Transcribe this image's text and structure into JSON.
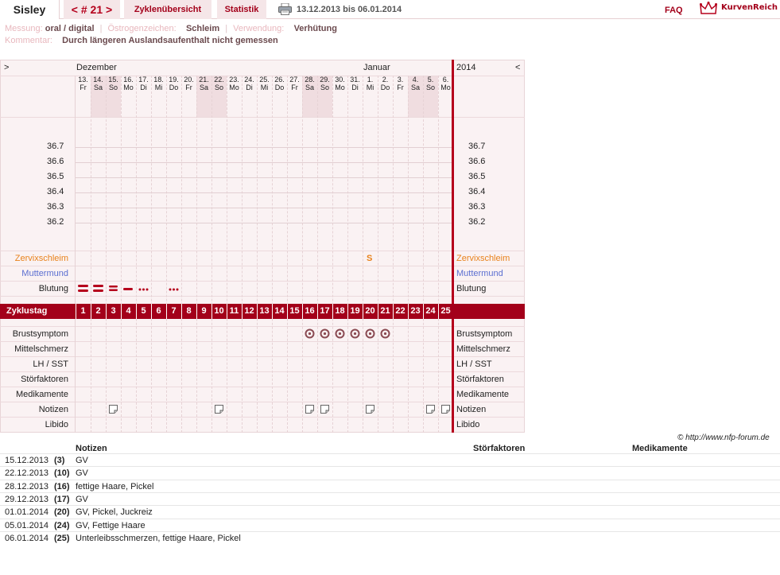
{
  "topbar": {
    "name": "Sisley",
    "cycle_prev": "<",
    "cycle_label": "# 21",
    "cycle_next": ">",
    "tab_overview": "Zyklenübersicht",
    "tab_stats": "Statistik",
    "date_range": "13.12.2013 bis 06.01.2014",
    "faq": "FAQ",
    "logo": "KurvenReich",
    "icons": [
      "printer-icon",
      "crown-logo-icon"
    ]
  },
  "meta": {
    "messung_label": "Messung:",
    "messung_value": "oral / digital",
    "oestrogen_label": "Östrogenzeichen:",
    "oestrogen_value": "Schleim",
    "verwendung_label": "Verwendung:",
    "verwendung_value": "Verhütung",
    "kommentar_label": "Kommentar:",
    "kommentar_value": "Durch längeren Auslandsaufenthalt nicht gemessen"
  },
  "chart": {
    "nav_left": ">",
    "nav_right": "<",
    "month1": "Dezember",
    "month2": "Januar",
    "year_right": "2014",
    "days": [
      {
        "d": "13.",
        "w": "Fr",
        "weekend": false
      },
      {
        "d": "14.",
        "w": "Sa",
        "weekend": true
      },
      {
        "d": "15.",
        "w": "So",
        "weekend": true
      },
      {
        "d": "16.",
        "w": "Mo",
        "weekend": false
      },
      {
        "d": "17.",
        "w": "Di",
        "weekend": false
      },
      {
        "d": "18.",
        "w": "Mi",
        "weekend": false
      },
      {
        "d": "19.",
        "w": "Do",
        "weekend": false
      },
      {
        "d": "20.",
        "w": "Fr",
        "weekend": false
      },
      {
        "d": "21.",
        "w": "Sa",
        "weekend": true
      },
      {
        "d": "22.",
        "w": "So",
        "weekend": true
      },
      {
        "d": "23.",
        "w": "Mo",
        "weekend": false
      },
      {
        "d": "24.",
        "w": "Di",
        "weekend": false
      },
      {
        "d": "25.",
        "w": "Mi",
        "weekend": false
      },
      {
        "d": "26.",
        "w": "Do",
        "weekend": false
      },
      {
        "d": "27.",
        "w": "Fr",
        "weekend": false
      },
      {
        "d": "28.",
        "w": "Sa",
        "weekend": true
      },
      {
        "d": "29.",
        "w": "So",
        "weekend": true
      },
      {
        "d": "30.",
        "w": "Mo",
        "weekend": false
      },
      {
        "d": "31.",
        "w": "Di",
        "weekend": false
      },
      {
        "d": "1.",
        "w": "Mi",
        "weekend": false
      },
      {
        "d": "2.",
        "w": "Do",
        "weekend": false
      },
      {
        "d": "3.",
        "w": "Fr",
        "weekend": false
      },
      {
        "d": "4.",
        "w": "Sa",
        "weekend": true
      },
      {
        "d": "5.",
        "w": "So",
        "weekend": true
      },
      {
        "d": "6.",
        "w": "Mo",
        "weekend": false
      }
    ],
    "temperatures": [
      "36.7",
      "36.6",
      "36.5",
      "36.4",
      "36.3",
      "36.2"
    ],
    "rows": {
      "zervixschleim": "Zervixschleim",
      "muttermund": "Muttermund",
      "blutung": "Blutung",
      "zyklustag": "Zyklustag",
      "brustsymptom": "Brustsymptom",
      "mittelschmerz": "Mittelschmerz",
      "lh_sst": "LH / SST",
      "stoerfaktoren": "Störfaktoren",
      "medikamente": "Medikamente",
      "notizen": "Notizen",
      "libido": "Libido"
    },
    "cycle_days": [
      "1",
      "2",
      "3",
      "4",
      "5",
      "6",
      "7",
      "8",
      "9",
      "10",
      "11",
      "12",
      "13",
      "14",
      "15",
      "16",
      "17",
      "18",
      "19",
      "20",
      "21",
      "22",
      "23",
      "24",
      "25"
    ],
    "zervix_marks": [
      {
        "day": 20,
        "symbol": "S"
      }
    ],
    "blutung_marks": [
      {
        "day": 1,
        "level": "heavy"
      },
      {
        "day": 2,
        "level": "heavy"
      },
      {
        "day": 3,
        "level": "medium"
      },
      {
        "day": 4,
        "level": "light"
      },
      {
        "day": 5,
        "level": "spotting"
      },
      {
        "day": 7,
        "level": "spotting"
      }
    ],
    "brust_days": [
      16,
      17,
      18,
      19,
      20,
      21
    ],
    "note_days": [
      3,
      10,
      16,
      17,
      20,
      24,
      25
    ]
  },
  "copyright": "© http://www.nfp-forum.de",
  "notes_table": {
    "headers": {
      "notizen": "Notizen",
      "stoerfaktoren": "Störfaktoren",
      "medikamente": "Medikamente"
    },
    "rows": [
      {
        "date": "15.12.2013",
        "day": "(3)",
        "text": "GV"
      },
      {
        "date": "22.12.2013",
        "day": "(10)",
        "text": "GV"
      },
      {
        "date": "28.12.2013",
        "day": "(16)",
        "text": "fettige Haare, Pickel"
      },
      {
        "date": "29.12.2013",
        "day": "(17)",
        "text": "GV"
      },
      {
        "date": "01.01.2014",
        "day": "(20)",
        "text": "GV, Pickel, Juckreiz"
      },
      {
        "date": "05.01.2014",
        "day": "(24)",
        "text": "GV, Fettige Haare"
      },
      {
        "date": "06.01.2014",
        "day": "(25)",
        "text": "Unterleibsschmerzen, fettige Haare, Pickel"
      }
    ]
  }
}
